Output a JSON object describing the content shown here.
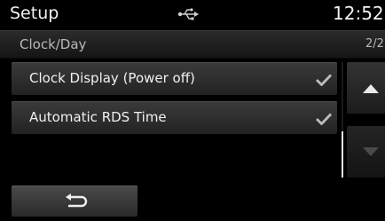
{
  "header": {
    "title": "Setup",
    "status_icon": "usb-icon",
    "clock": "12:52"
  },
  "subheader": {
    "breadcrumb": "Clock/Day",
    "page": "2/2"
  },
  "list": {
    "items": [
      {
        "label": "Clock Display (Power off)",
        "checked": true,
        "icon": "check-icon"
      },
      {
        "label": "Automatic RDS Time",
        "checked": true,
        "icon": "check-icon"
      }
    ]
  },
  "scroll": {
    "up_icon": "arrow-up-icon",
    "down_icon": "arrow-down-icon"
  },
  "footer": {
    "back_icon": "back-arrow-icon"
  },
  "colors": {
    "background": "#000000",
    "text": "#f0f0f0",
    "secondary_text": "#b9b9b9",
    "check": "#bdbdbd"
  }
}
